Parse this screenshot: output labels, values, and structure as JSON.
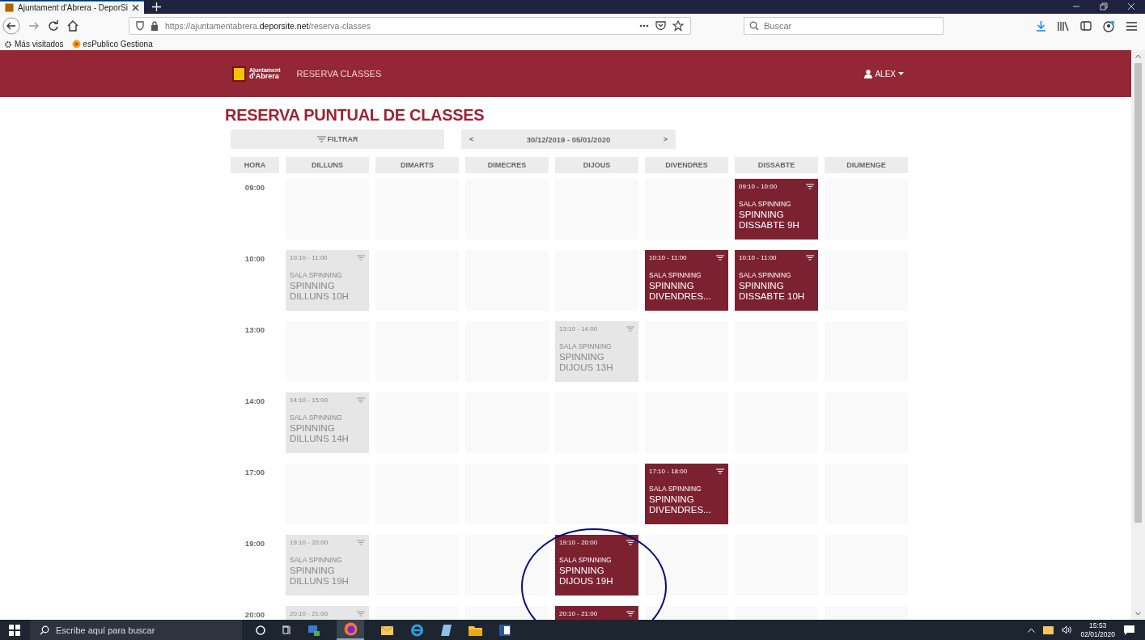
{
  "browser": {
    "tab_title": "Ajuntament d'Abrera - DeporSi",
    "url_prefix": "https://ajuntamentabrera.",
    "url_domain": "deporsite.net",
    "url_path": "/reserva-classes",
    "search_placeholder": "Buscar",
    "bookmarks": [
      "Más visitados",
      "esPublico Gestiona"
    ]
  },
  "site": {
    "logo_line_1": "Ajuntament",
    "logo_line_2": "d'Abrera",
    "nav_link": "RESERVA CLASSES",
    "user": "ALEX"
  },
  "page": {
    "title": "RESERVA PUNTUAL DE CLASSES",
    "filter_button": "FILTRAR",
    "prev": "<",
    "date_range": "30/12/2019 - 05/01/2020",
    "next": ">"
  },
  "columns": [
    "HORA",
    "DILLUNS",
    "DIMARTS",
    "DIMECRES",
    "DIJOUS",
    "DIVENDRES",
    "DISSABTE",
    "DIUMENGE"
  ],
  "rows": [
    {
      "hour": "09:00",
      "cells": [
        {
          "kind": "empty"
        },
        {
          "kind": "empty"
        },
        {
          "kind": "empty"
        },
        {
          "kind": "empty"
        },
        {
          "kind": "empty"
        },
        {
          "kind": "class",
          "available": true,
          "time": "09:10 - 10:00",
          "room": "SALA SPINNING",
          "name": "SPINNING DISSABTE 9H"
        },
        {
          "kind": "empty"
        }
      ]
    },
    {
      "hour": "10:00",
      "cells": [
        {
          "kind": "class",
          "available": false,
          "time": "10:10 - 11:00",
          "room": "SALA SPINNING",
          "name": "SPINNING DILLUNS 10H"
        },
        {
          "kind": "empty"
        },
        {
          "kind": "empty"
        },
        {
          "kind": "empty"
        },
        {
          "kind": "class",
          "available": true,
          "time": "10:10 - 11:00",
          "room": "SALA SPINNING",
          "name": "SPINNING DIVENDRES..."
        },
        {
          "kind": "class",
          "available": true,
          "time": "10:10 - 11:00",
          "room": "SALA SPINNING",
          "name": "SPINNING DISSABTE 10H"
        },
        {
          "kind": "empty"
        }
      ]
    },
    {
      "hour": "13:00",
      "cells": [
        {
          "kind": "empty"
        },
        {
          "kind": "empty"
        },
        {
          "kind": "empty"
        },
        {
          "kind": "class",
          "available": false,
          "time": "13:10 - 14:00",
          "room": "SALA SPINNING",
          "name": "SPINNING DIJOUS 13H"
        },
        {
          "kind": "empty"
        },
        {
          "kind": "empty"
        },
        {
          "kind": "empty"
        }
      ]
    },
    {
      "hour": "14:00",
      "cells": [
        {
          "kind": "class",
          "available": false,
          "time": "14:10 - 15:00",
          "room": "SALA SPINNING",
          "name": "SPINNING DILLUNS 14H"
        },
        {
          "kind": "empty"
        },
        {
          "kind": "empty"
        },
        {
          "kind": "empty"
        },
        {
          "kind": "empty"
        },
        {
          "kind": "empty"
        },
        {
          "kind": "empty"
        }
      ]
    },
    {
      "hour": "17:00",
      "cells": [
        {
          "kind": "empty"
        },
        {
          "kind": "empty"
        },
        {
          "kind": "empty"
        },
        {
          "kind": "empty"
        },
        {
          "kind": "class",
          "available": true,
          "time": "17:10 - 18:00",
          "room": "SALA SPINNING",
          "name": "SPINNING DIVENDRES..."
        },
        {
          "kind": "empty"
        },
        {
          "kind": "empty"
        }
      ]
    },
    {
      "hour": "19:00",
      "cells": [
        {
          "kind": "class",
          "available": false,
          "time": "19:10 - 20:00",
          "room": "SALA SPINNING",
          "name": "SPINNING DILLUNS 19H"
        },
        {
          "kind": "empty"
        },
        {
          "kind": "empty"
        },
        {
          "kind": "class",
          "available": true,
          "time": "19:10 - 20:00",
          "room": "SALA SPINNING",
          "name": "SPINNING DIJOUS 19H"
        },
        {
          "kind": "empty"
        },
        {
          "kind": "empty"
        },
        {
          "kind": "empty"
        }
      ]
    },
    {
      "hour": "20:00",
      "cells": [
        {
          "kind": "class",
          "available": false,
          "time": "20:10 - 21:00"
        },
        {
          "kind": "empty"
        },
        {
          "kind": "empty"
        },
        {
          "kind": "class",
          "available": true,
          "time": "20:10 - 21:00"
        },
        {
          "kind": "empty"
        },
        {
          "kind": "empty"
        },
        {
          "kind": "empty"
        }
      ]
    }
  ],
  "taskbar": {
    "search_placeholder": "Escribe aquí para buscar",
    "time": "15:53",
    "date": "02/01/2020"
  }
}
